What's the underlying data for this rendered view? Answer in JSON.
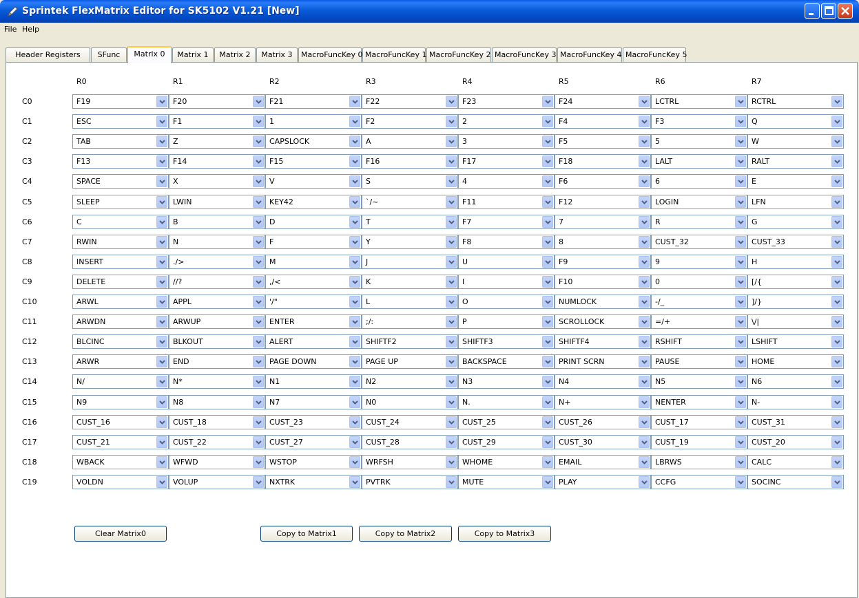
{
  "window": {
    "title": "Sprintek FlexMatrix Editor for SK5102 V1.21  [New]"
  },
  "menu": [
    "File",
    "Help"
  ],
  "tabs": [
    "Header Registers",
    "SFunc",
    "Matrix 0",
    "Matrix 1",
    "Matrix 2",
    "Matrix 3",
    "MacroFuncKey 0",
    "MacroFuncKey 1",
    "MacroFuncKey 2",
    "MacroFuncKey 3",
    "MacroFuncKey 4",
    "MacroFuncKey 5"
  ],
  "active_tab": "Matrix 0",
  "grid": {
    "columns": [
      "R0",
      "R1",
      "R2",
      "R3",
      "R4",
      "R5",
      "R6",
      "R7"
    ],
    "rows": [
      {
        "label": "C0",
        "values": [
          "F19",
          "F20",
          "F21",
          "F22",
          "F23",
          "F24",
          "LCTRL",
          "RCTRL"
        ]
      },
      {
        "label": "C1",
        "values": [
          "ESC",
          "F1",
          "1",
          "F2",
          "2",
          "F4",
          "F3",
          "Q"
        ]
      },
      {
        "label": "C2",
        "values": [
          "TAB",
          "Z",
          "CAPSLOCK",
          "A",
          "3",
          "F5",
          "5",
          "W"
        ]
      },
      {
        "label": "C3",
        "values": [
          "F13",
          "F14",
          "F15",
          "F16",
          "F17",
          "F18",
          "LALT",
          "RALT"
        ]
      },
      {
        "label": "C4",
        "values": [
          "SPACE",
          "X",
          "V",
          "S",
          "4",
          "F6",
          "6",
          "E"
        ]
      },
      {
        "label": "C5",
        "values": [
          "SLEEP",
          "LWIN",
          "KEY42",
          "`/~",
          "F11",
          "F12",
          "LOGIN",
          "LFN"
        ]
      },
      {
        "label": "C6",
        "values": [
          "C",
          "B",
          "D",
          "T",
          "F7",
          "7",
          "R",
          "G"
        ]
      },
      {
        "label": "C7",
        "values": [
          "RWIN",
          "N",
          "F",
          "Y",
          "F8",
          "8",
          "CUST_32",
          "CUST_33"
        ]
      },
      {
        "label": "C8",
        "values": [
          "INSERT",
          "./>",
          "M",
          "J",
          "U",
          "F9",
          "9",
          "H"
        ]
      },
      {
        "label": "C9",
        "values": [
          "DELETE",
          "//?",
          ",/<",
          "K",
          "I",
          "F10",
          "0",
          "[/{"
        ]
      },
      {
        "label": "C10",
        "values": [
          "ARWL",
          "APPL",
          "'/\"",
          "L",
          "O",
          "NUMLOCK",
          "-/_",
          "]/}"
        ]
      },
      {
        "label": "C11",
        "values": [
          "ARWDN",
          "ARWUP",
          "ENTER",
          ";/:",
          "P",
          "SCROLLOCK",
          "=/+",
          "\\/|"
        ]
      },
      {
        "label": "C12",
        "values": [
          "BLCINC",
          "BLKOUT",
          "ALERT",
          "SHIFTF2",
          "SHIFTF3",
          "SHIFTF4",
          "RSHIFT",
          "LSHIFT"
        ]
      },
      {
        "label": "C13",
        "values": [
          "ARWR",
          "END",
          "PAGE DOWN",
          "PAGE UP",
          "BACKSPACE",
          "PRINT SCRN",
          "PAUSE",
          "HOME"
        ]
      },
      {
        "label": "C14",
        "values": [
          "N/",
          "N*",
          "N1",
          "N2",
          "N3",
          "N4",
          "N5",
          "N6"
        ]
      },
      {
        "label": "C15",
        "values": [
          "N9",
          "N8",
          "N7",
          "N0",
          "N.",
          "N+",
          "NENTER",
          "N-"
        ]
      },
      {
        "label": "C16",
        "values": [
          "CUST_16",
          "CUST_18",
          "CUST_23",
          "CUST_24",
          "CUST_25",
          "CUST_26",
          "CUST_17",
          "CUST_31"
        ]
      },
      {
        "label": "C17",
        "values": [
          "CUST_21",
          "CUST_22",
          "CUST_27",
          "CUST_28",
          "CUST_29",
          "CUST_30",
          "CUST_19",
          "CUST_20"
        ]
      },
      {
        "label": "C18",
        "values": [
          "WBACK",
          "WFWD",
          "WSTOP",
          "WRFSH",
          "WHOME",
          "EMAIL",
          "LBRWS",
          "CALC"
        ]
      },
      {
        "label": "C19",
        "values": [
          "VOLDN",
          "VOLUP",
          "NXTRK",
          "PVTRK",
          "MUTE",
          "PLAY",
          "CCFG",
          "SOCINC"
        ]
      }
    ]
  },
  "buttons": {
    "clear": "Clear Matrix0",
    "copy1": "Copy to Matrix1",
    "copy2": "Copy to Matrix2",
    "copy3": "Copy to Matrix3"
  },
  "icons": {
    "app": "pencil-icon",
    "combo_arrow": "chevron-down-icon",
    "minimize": "minimize-icon",
    "maximize": "maximize-icon",
    "close": "close-icon"
  },
  "colors": {
    "titlebar": "#0a5bd8",
    "combo_border": "#7f9db9",
    "active_tab_accent": "#ffc83c",
    "window_bg": "#ece9d8"
  }
}
